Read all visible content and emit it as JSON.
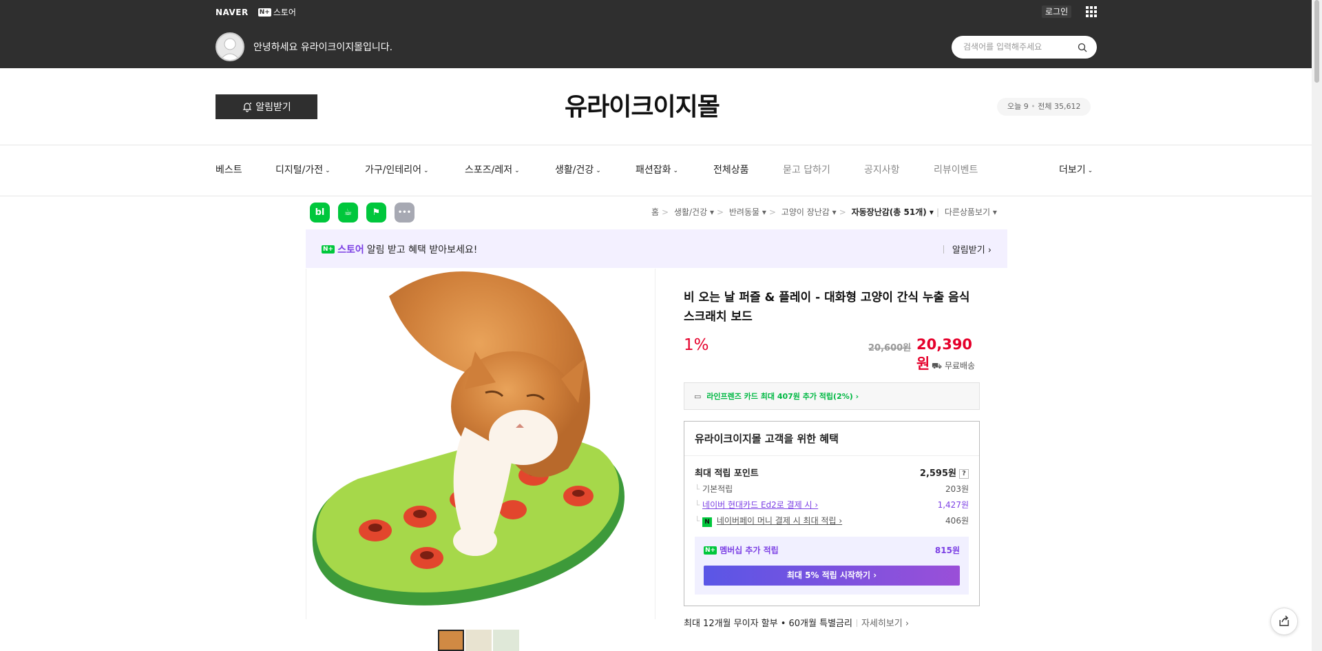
{
  "gnb": {
    "naver": "NAVER",
    "nstore_badge": "N+",
    "nstore_label": "스토어",
    "login": "로그인"
  },
  "header": {
    "greeting": "안녕하세요 유라이크이지몰입니다.",
    "search_placeholder": "검색어를 입력해주세요"
  },
  "store": {
    "notify_button": "알림받기",
    "title": "유라이크이지몰",
    "visitors_today": "오늘 9",
    "visitors_total": "전체 35,612"
  },
  "categories": [
    {
      "label": "베스트",
      "dropdown": false
    },
    {
      "label": "디지털/가전",
      "dropdown": true
    },
    {
      "label": "가구/인테리어",
      "dropdown": true
    },
    {
      "label": "스포즈/레저",
      "dropdown": true
    },
    {
      "label": "생활/건강",
      "dropdown": true
    },
    {
      "label": "패션잡화",
      "dropdown": true
    },
    {
      "label": "전체상품",
      "dropdown": false
    },
    {
      "label": "묻고 답하기",
      "dropdown": false
    },
    {
      "label": "공지사항",
      "dropdown": false
    },
    {
      "label": "리뷰이벤트",
      "dropdown": false
    },
    {
      "label": "더보기",
      "dropdown": true
    }
  ],
  "share_buttons": [
    {
      "label": "bl",
      "color": "#00c73c"
    },
    {
      "label": "☕",
      "color": "#00c73c"
    },
    {
      "label": "⚑",
      "color": "#00c73c"
    },
    {
      "label": "•••",
      "color": "#a7a9b3"
    }
  ],
  "breadcrumb": {
    "home": "홈",
    "c1": "생활/건강",
    "c2": "반려동물",
    "c3": "고양이 장난감",
    "c4": "자동장난감(총 51개)",
    "other": "다른상품보기"
  },
  "banner": {
    "store_badge": "N+",
    "store_label": "스토어",
    "text": "알림 받고 혜택 받아보세요!",
    "action": "알림받기 ›"
  },
  "product": {
    "name": "비 오는 날 퍼즐 & 플레이 - 대화형 고양이 간식 누출 음식 스크래치 보드",
    "discount": "1%",
    "original_price": "20,600원",
    "sale_price": "20,390원",
    "shipping": "무료배송",
    "card_promo": "라인프렌즈 카드 최대 407원 추가 적립(2%) ›"
  },
  "benefits": {
    "title": "유라이크이지몰 고객을 위한 혜택",
    "max_points_label": "최대 적립 포인트",
    "max_points_value": "2,595원",
    "q": "?",
    "rows": [
      {
        "label": "기본적립",
        "value": "203원"
      },
      {
        "label": "네이버 현대카드 Ed2로 결제 시 ›",
        "value": "1,427원"
      },
      {
        "label": "네이버페이 머니 결제 시 최대 적립 ›",
        "value": "406원"
      }
    ],
    "npay_icon": "N",
    "membership_label": "멤버십 추가 적립",
    "membership_value": "815원",
    "membership_button": "최대 5% 적립 시작하기 ›"
  },
  "installment": {
    "text": "최대 12개월 무이자 할부 • 60개월 특별금리",
    "more": "자세히보기 ›"
  }
}
